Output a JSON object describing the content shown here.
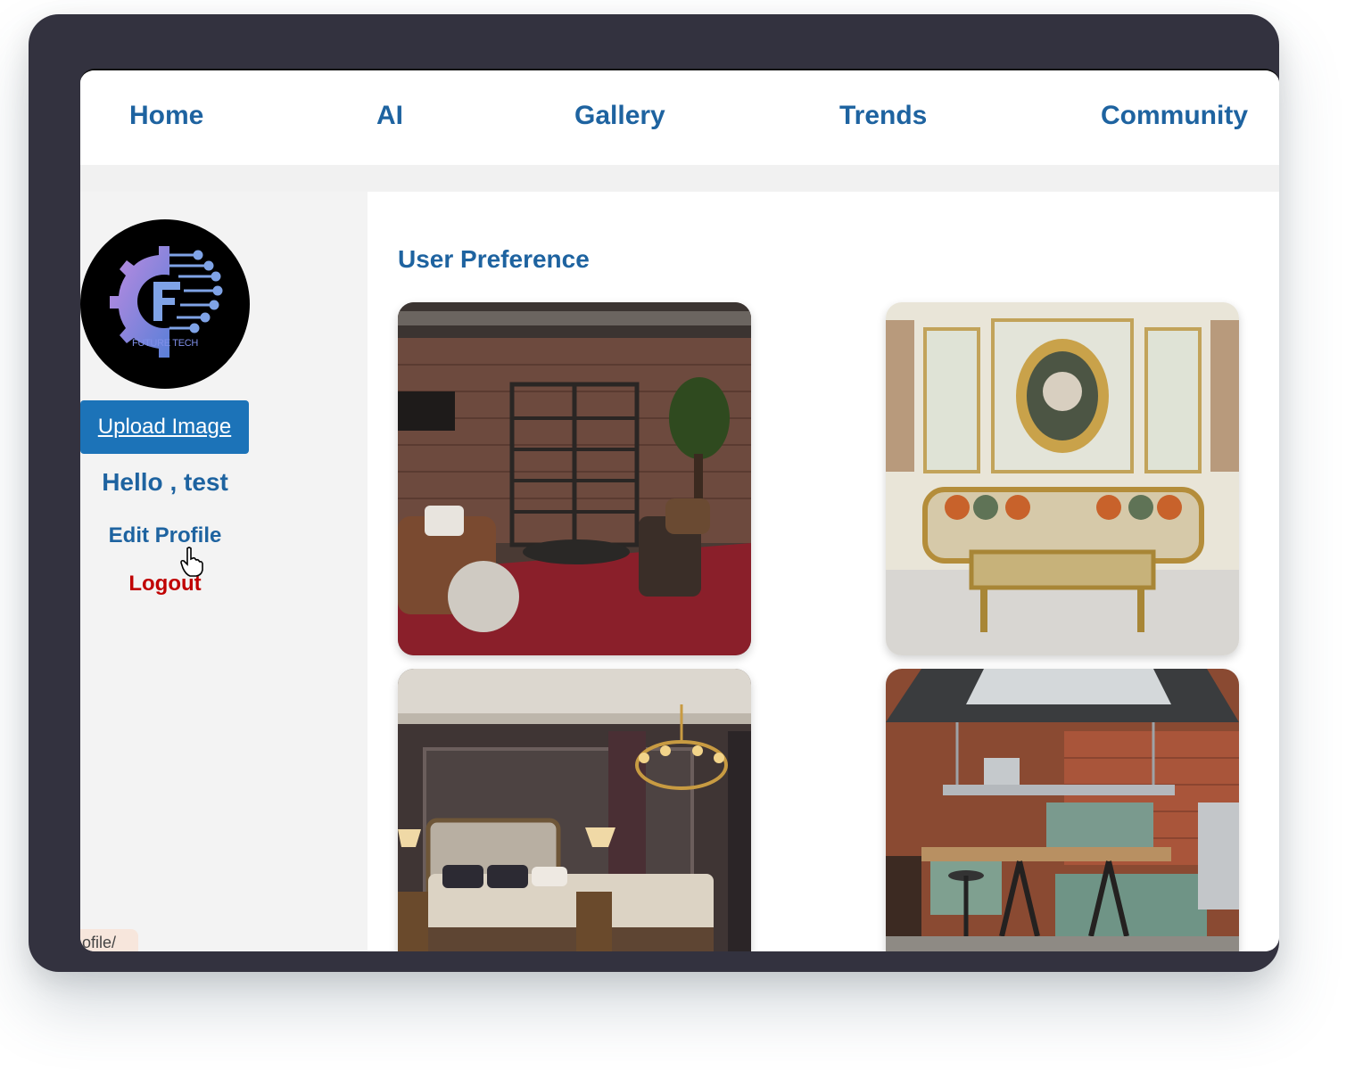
{
  "nav": {
    "items": [
      {
        "label": "Home"
      },
      {
        "label": "AI"
      },
      {
        "label": "Gallery"
      },
      {
        "label": "Trends"
      },
      {
        "label": "Community"
      }
    ]
  },
  "sidebar": {
    "avatar_brand": "FUTURE TECH",
    "upload_label": "Upload Image",
    "greeting": "Hello , test",
    "edit_profile": "Edit Profile",
    "logout": "Logout",
    "status_url": "ofile/"
  },
  "main": {
    "title": "User Preference",
    "images": [
      {
        "name": "industrial-living-room-image"
      },
      {
        "name": "baroque-living-room-image"
      },
      {
        "name": "classic-bedroom-image"
      },
      {
        "name": "industrial-kitchen-image"
      }
    ]
  },
  "colors": {
    "accent": "#1e63a0",
    "button": "#1c73b8",
    "logout": "#c00000",
    "frame": "#33323f"
  }
}
